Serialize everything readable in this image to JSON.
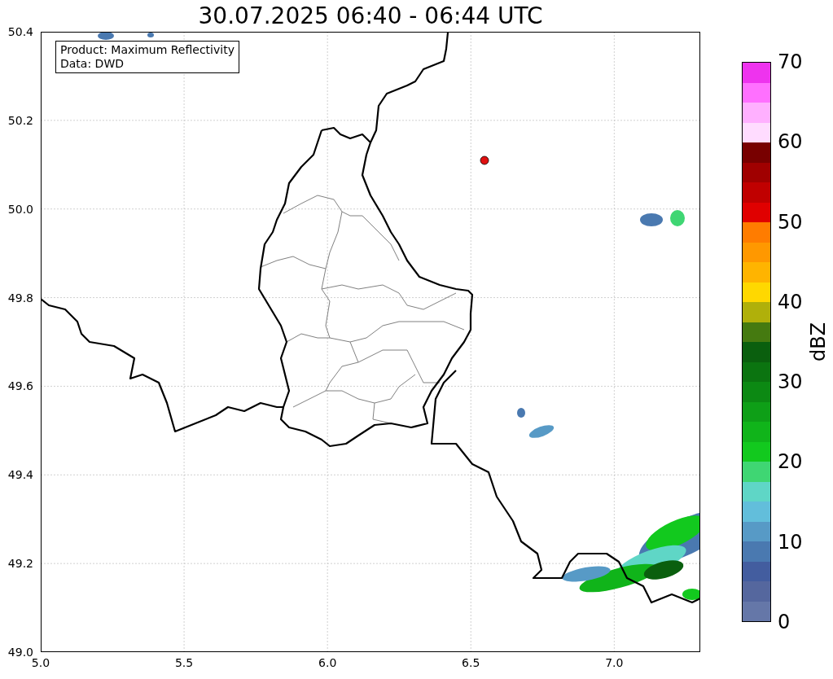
{
  "title": "30.07.2025 06:40 - 06:44 UTC",
  "annotation": {
    "lines": [
      "Product: Maximum Reflectivity",
      "Data: DWD"
    ]
  },
  "x_axis": {
    "ticks": [
      "5.0",
      "5.5",
      "6.0",
      "6.5",
      "7.0"
    ]
  },
  "y_axis": {
    "ticks": [
      "50.4",
      "50.2",
      "50.0",
      "49.8",
      "49.6",
      "49.4",
      "49.2",
      "49.0"
    ]
  },
  "colorbar": {
    "label": "dBZ",
    "ticks": [
      "70",
      "60",
      "50",
      "40",
      "30",
      "20",
      "10",
      "0"
    ],
    "segments": [
      {
        "color": "#6577a8"
      },
      {
        "color": "#55679e"
      },
      {
        "color": "#435d9f"
      },
      {
        "color": "#4a79b0"
      },
      {
        "color": "#579ac6"
      },
      {
        "color": "#62bedb"
      },
      {
        "color": "#5fd6c6"
      },
      {
        "color": "#3fd673"
      },
      {
        "color": "#12c91e"
      },
      {
        "color": "#10b41a"
      },
      {
        "color": "#0e9f17"
      },
      {
        "color": "#0c8913"
      },
      {
        "color": "#0b7410"
      },
      {
        "color": "#0a5f0e"
      },
      {
        "color": "#457a10"
      },
      {
        "color": "#b0b00a"
      },
      {
        "color": "#ffd800"
      },
      {
        "color": "#ffb400"
      },
      {
        "color": "#ff9800"
      },
      {
        "color": "#ff7c00"
      },
      {
        "color": "#e00000"
      },
      {
        "color": "#c00000"
      },
      {
        "color": "#a00000"
      },
      {
        "color": "#780000"
      },
      {
        "color": "#ffdcff"
      },
      {
        "color": "#ffb0ff"
      },
      {
        "color": "#ff70ff"
      },
      {
        "color": "#ee33ee"
      }
    ]
  }
}
